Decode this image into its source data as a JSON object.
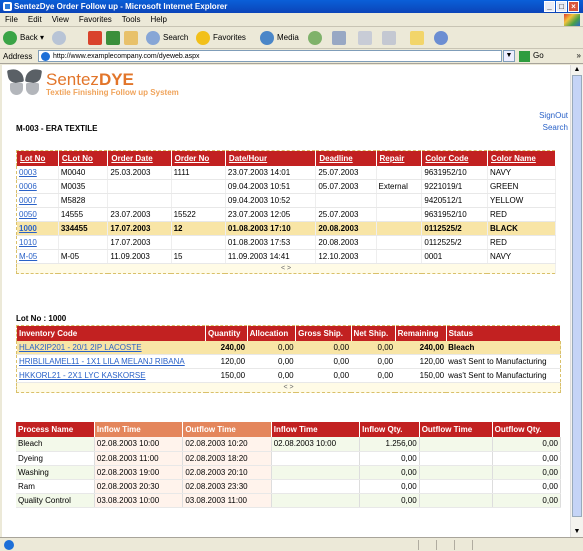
{
  "window": {
    "title": "SentezDye Order Follow up - Microsoft Internet Explorer"
  },
  "menu": [
    "File",
    "Edit",
    "View",
    "Favorites",
    "Tools",
    "Help"
  ],
  "toolbar": {
    "back": "Back",
    "search": "Search",
    "favorites": "Favorites",
    "media": "Media"
  },
  "address": {
    "label": "Address",
    "url": "http://www.examplecompany.com/dyeweb.aspx",
    "go": "Go"
  },
  "brand": {
    "name1": "Sentez",
    "name2": "DYE",
    "tagline": "Textile Finishing Follow up System"
  },
  "page": {
    "signout": "SignOut",
    "search": "Search",
    "firm": "M-003 - ERA TEXTILE",
    "lot_label": "Lot No : 1000"
  },
  "lots": {
    "columns": [
      "Lot No",
      "CLot No",
      "Order Date",
      "Order No",
      "Date/Hour",
      "Deadline",
      "Repair",
      "Color Code",
      "Color Name"
    ],
    "rows": [
      [
        "0003",
        "M0040",
        "25.03.2003",
        "1111",
        "23.07.2003 14:01",
        "25.07.2003",
        "",
        "9631952/10",
        "NAVY"
      ],
      [
        "0006",
        "M0035",
        "",
        "",
        "09.04.2003 10:51",
        "05.07.2003",
        "External",
        "9221019/1",
        "GREEN"
      ],
      [
        "0007",
        "M5828",
        "",
        "",
        "09.04.2003 10:52",
        "",
        "",
        "9420512/1",
        "YELLOW"
      ],
      [
        "0050",
        "14555",
        "23.07.2003",
        "15522",
        "23.07.2003 12:05",
        "25.07.2003",
        "",
        "9631952/10",
        "RED"
      ],
      [
        "1000",
        "334455",
        "17.07.2003",
        "12",
        "01.08.2003 17:10",
        "20.08.2003",
        "",
        "0112525/2",
        "BLACK"
      ],
      [
        "1010",
        "",
        "17.07.2003",
        "",
        "01.08.2003 17:53",
        "20.08.2003",
        "",
        "0112525/2",
        "RED"
      ],
      [
        "M-05",
        "M-05",
        "11.09.2003",
        "15",
        "11.09.2003 14:41",
        "12.10.2003",
        "",
        "0001",
        "NAVY"
      ]
    ],
    "selected_index": 4,
    "pager": "< >"
  },
  "inventory": {
    "columns": [
      "Inventory Code",
      "Quantity",
      "Allocation",
      "Gross Ship.",
      "Net Ship.",
      "Remaining",
      "Status"
    ],
    "rows": [
      [
        "HLAK2IP201 - 20/1 2IP LACOSTE",
        "240,00",
        "0,00",
        "0,00",
        "0,00",
        "240,00",
        "Bleach"
      ],
      [
        "HRIBLILAMEL11 - 1X1 LILA MELANJ RIBANA",
        "120,00",
        "0,00",
        "0,00",
        "0,00",
        "120,00",
        "was't Sent to Manufacturing"
      ],
      [
        "HKKORL21 - 2X1 LYC KASKORSE",
        "150,00",
        "0,00",
        "0,00",
        "0,00",
        "150,00",
        "was't Sent to Manufacturing"
      ]
    ],
    "pager": "< >"
  },
  "process": {
    "columns": [
      "Process Name",
      "Inflow Time",
      "Outflow Time",
      "Inflow Time",
      "Inflow Qty.",
      "Outflow Time",
      "Outflow Qty."
    ],
    "rows": [
      [
        "Bleach",
        "02.08.2003 10:00",
        "02.08.2003 10:20",
        "02.08.2003 10:00",
        "1.256,00",
        "",
        "0,00"
      ],
      [
        "Dyeing",
        "02.08.2003 11:00",
        "02.08.2003 18:20",
        "",
        "0,00",
        "",
        "0,00"
      ],
      [
        "Washing",
        "02.08.2003 19:00",
        "02.08.2003 20:10",
        "",
        "0,00",
        "",
        "0,00"
      ],
      [
        "Ram",
        "02.08.2003 20:30",
        "02.08.2003 23:30",
        "",
        "0,00",
        "",
        "0,00"
      ],
      [
        "Quality Control",
        "03.08.2003 10:00",
        "03.08.2003 11:00",
        "",
        "0,00",
        "",
        "0,00"
      ]
    ]
  },
  "colors": {
    "header_red": "#c22121",
    "header_orange": "#e4865c",
    "brand_orange": "#e2752a",
    "link_blue": "#2a62c8",
    "selected_row": "#f8e5a6"
  }
}
